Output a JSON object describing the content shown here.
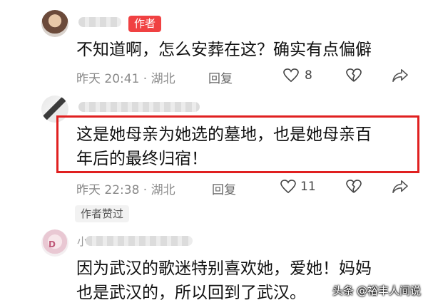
{
  "comments": [
    {
      "username": "",
      "badge": "作者",
      "text": "不知道啊，怎么安葬在这？确实有点偏僻",
      "time": "昨天 20:41",
      "location": "湖北",
      "reply": "回复",
      "likes": "8"
    },
    {
      "username": "",
      "text_line1": "这是她母亲为她选的墓地，也是她母亲百",
      "text_line2": "年后的最终归宿！",
      "time": "昨天 22:38",
      "location": "湖北",
      "reply": "回复",
      "likes": "11",
      "author_liked": "作者赞过"
    },
    {
      "username": "小",
      "text_line1": "因为武汉的歌迷特别喜欢她，爱她！妈妈",
      "text_line2": "也是武汉的，所以回到了武汉。"
    }
  ],
  "watermark": {
    "source": "头条",
    "handle": "@裕丰人间说"
  },
  "colors": {
    "badge": "#f04142",
    "highlight_border": "#e02020"
  },
  "icons": [
    "heart-icon",
    "broken-heart-icon",
    "share-icon"
  ]
}
